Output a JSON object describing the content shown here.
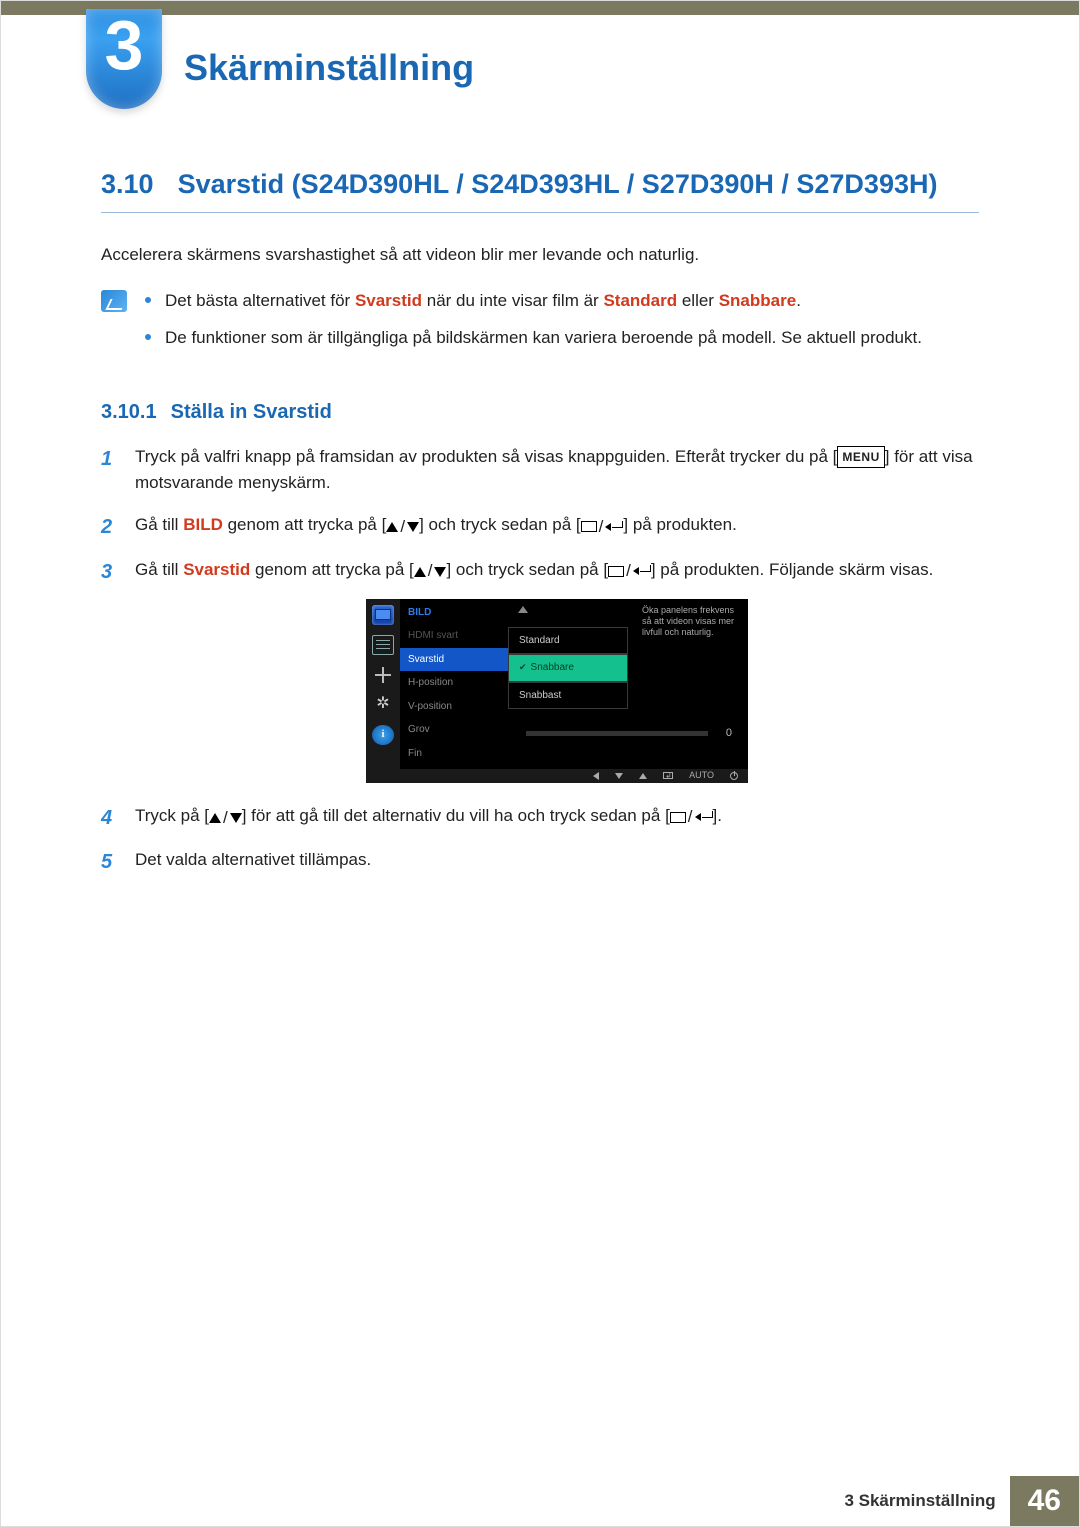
{
  "chapter": {
    "number": "3",
    "title": "Skärminställning"
  },
  "section": {
    "number": "3.10",
    "title": "Svarstid (S24D390HL / S24D393HL / S27D390H / S27D393H)"
  },
  "intro": "Accelerera skärmens svarshastighet så att videon blir mer levande och naturlig.",
  "notes": {
    "a_pre": "Det bästa alternativet för ",
    "a_hl1": "Svarstid",
    "a_mid": " när du inte visar film är ",
    "a_hl2": "Standard",
    "a_mid2": " eller ",
    "a_hl3": "Snabbare",
    "a_end": ".",
    "b": "De funktioner som är tillgängliga på bildskärmen kan variera beroende på modell. Se aktuell produkt."
  },
  "subsection": {
    "number": "3.10.1",
    "title": "Ställa in Svarstid"
  },
  "steps": {
    "s1a": "Tryck på valfri knapp på framsidan av produkten så visas knappguiden. Efteråt trycker du på [",
    "s1b": "] för att visa motsvarande menyskärm.",
    "s2a": "Gå till ",
    "s2hl": "BILD",
    "s2b": " genom att trycka på [",
    "s2c": "] och tryck sedan på [",
    "s2d": "] på produkten.",
    "s3a": "Gå till ",
    "s3hl": "Svarstid",
    "s3b": " genom att trycka på [",
    "s3c": "] och tryck sedan på [",
    "s3d": "] på produkten. Följande skärm visas.",
    "s4a": "Tryck på [",
    "s4b": "] för att gå till det alternativ du vill ha och tryck sedan på [",
    "s4c": "].",
    "s5": "Det valda alternativet tillämpas.",
    "menu_label": "MENU"
  },
  "osd": {
    "title": "BILD",
    "items": {
      "hdmi": "HDMI svart",
      "svarstid": "Svarstid",
      "hpos": "H-position",
      "vpos": "V-position",
      "grov": "Grov",
      "fin": "Fin"
    },
    "opts": {
      "standard": "Standard",
      "snabbare": "Snabbare",
      "snabbast": "Snabbast"
    },
    "help": "Öka panelens frekvens så att videon visas mer livfull och naturlig.",
    "slider_value": "0",
    "auto": "AUTO"
  },
  "footer": {
    "text": "3 Skärminställning",
    "page": "46"
  }
}
